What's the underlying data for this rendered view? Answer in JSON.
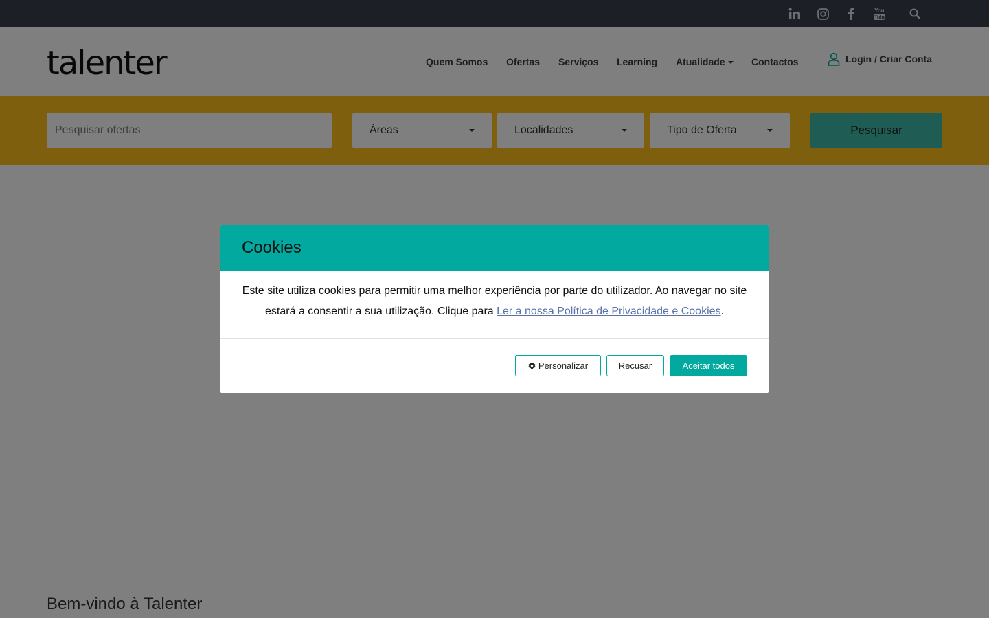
{
  "topbar": {
    "icons": [
      "linkedin-icon",
      "instagram-icon",
      "facebook-icon",
      "youtube-icon",
      "search-icon"
    ]
  },
  "header": {
    "logo_text": "talenter",
    "nav": {
      "quem_somos": "Quem Somos",
      "ofertas": "Ofertas",
      "servicos": "Serviços",
      "learning": "Learning",
      "atualidade": "Atualidade",
      "contactos": "Contactos"
    },
    "login_label": "Login / Criar Conta"
  },
  "search": {
    "placeholder": "Pesquisar ofertas",
    "areas": "Áreas",
    "localidades": "Localidades",
    "tipo_oferta": "Tipo de Oferta",
    "button": "Pesquisar"
  },
  "main": {
    "welcome": "Bem-vindo à Talenter"
  },
  "cookie_modal": {
    "title": "Cookies",
    "body_text": "Este site utiliza cookies para permitir uma melhor experiência por parte do utilizador. Ao navegar no site estará a consentir a sua utilização. Clique para ",
    "link_text": "Ler a nossa Política de Privacidade e Cookies",
    "body_end": ".",
    "personalizar": "Personalizar",
    "recusar": "Recusar",
    "aceitar": "Aceitar todos"
  },
  "colors": {
    "topbar": "#393f4c",
    "search_band": "#fcbe1c",
    "accent": "#02a99e",
    "search_button": "#3fb8a6"
  }
}
